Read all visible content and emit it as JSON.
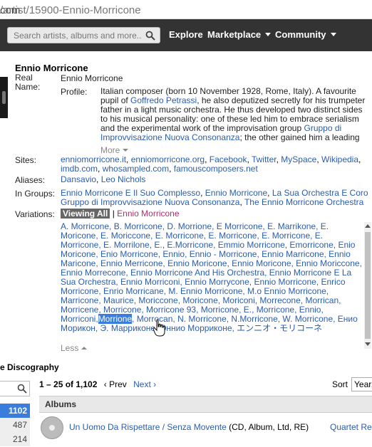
{
  "browser": {
    "url_prefix": "com",
    "url_path": "/artist/15900-Ennio-Morricone"
  },
  "header": {
    "search_placeholder": "Search artists, albums and more...",
    "nav": [
      "Explore",
      "Marketplace",
      "Community"
    ]
  },
  "artist": {
    "name": "Ennio Morricone",
    "real_name_label": "Real Name:",
    "real_name": "Ennio Morricone",
    "profile_label": "Profile:",
    "profile_parts": [
      "Italian composer (born 10 November 1928, Rome, Italy). A favourite pupil of ",
      "Goffredo Petrassi",
      ", he also deputized secretly for his trumpeter father in a light music orchestra. He thus developed two distinct sides to his musical personality: one of these led him to embrace serialism and the experimental work of the improvisation group ",
      "Gruppo di Improvvisazione Nuova Consonanza",
      "; the other gained him a leading"
    ],
    "more_label": "More",
    "sites_label": "Sites:",
    "sites": [
      "enniomorricone.it",
      "enniomorricone.org",
      "Facebook",
      "Twitter",
      "MySpace",
      "Wikipedia",
      "imdb.com",
      "whosampled.com",
      "famouscomposers.net"
    ],
    "aliases_label": "Aliases:",
    "aliases": [
      "Dansavio",
      "Leo Nichols"
    ],
    "groups_label": "In Groups:",
    "groups": [
      "Ennio Morricone E Il Suo Complesso",
      "Ennio Morricone",
      "La Sua Orchestra E Coro",
      "Gruppo di Improvvisazione Nuova Consonanza",
      "The Ennio Morricone Orchestra"
    ],
    "variations_label": "Variations:",
    "viewing_all": "Viewing All",
    "variation_filter": "Ennio Morricone",
    "variations_text_before": "A. Morricone, B. Morricone, D. Morrione, E Morricone, E. Marrikone, E. Moricone, E. Moriccone, E. Morricone, E. Morricone, E. Morricone, E. Morricone, E. Morrilone, E., E.Morricone, Emmio Morricone, Emorricone, Enio Moricone, Enio Morricone, Ennio, Ennio - Morricone, Ennio Marricone, Ennio Maricone, Ennio Merricone, Ennio Moricone, Ennio Moricone, Ennio Moriccone, Ennio Morrecone, Ennio Morricone And His Orchestra, Ennio Morricone E La Sua Orchestra, Ennio Morriconi, Ennio Morrycone, Ennio Morricone, Enrico Morricone, Enrio Morricane, M. Ennio Morricone, M.o Ennio Morricone, Marricone, Maurice, Moriccone, Moricone, Moriconi, Morrecone, Morrican, Morricene, Morricone, Morricone 93, Morricone, E., Morricone, Ennio, Morriconi,",
    "variation_selected": "Morrione",
    "variations_text_after": ", Morrocan, N. Morricone, N.Morricone, W. Morricone, Енио Морикон, Э. Марриконе, Эннио Морриконе, エンニオ・モリコーネ",
    "less_label": "Less"
  },
  "discography": {
    "title": "e Discography",
    "range": "1 – 25 of 1,102",
    "prev": "Prev",
    "next": "Next",
    "sort_label": "Sort",
    "sort_value": "Year,",
    "counts": [
      "1102",
      "487",
      "214"
    ],
    "section": "Albums",
    "release_title": "Un Uomo Da Rispettare / Senza Movente",
    "release_format": "(CD, Album, Ltd, RE)",
    "release_artist": "Quartet Re"
  }
}
